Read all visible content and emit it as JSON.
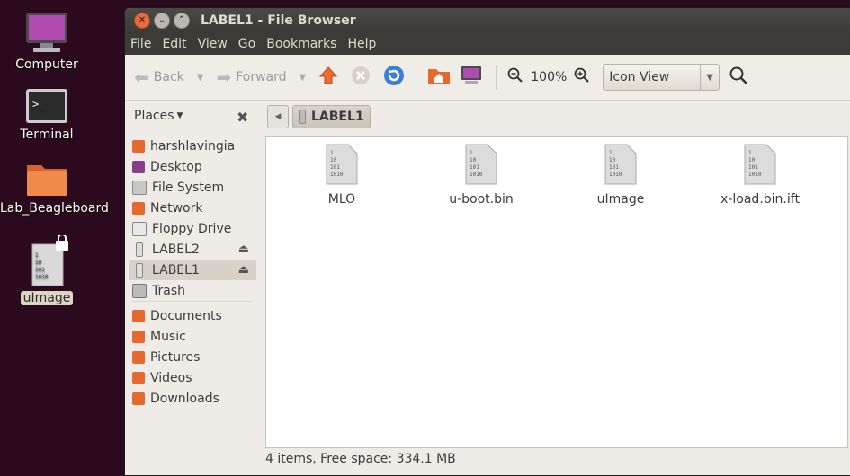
{
  "desktop": {
    "icons": [
      {
        "label": "Computer"
      },
      {
        "label": "Terminal"
      },
      {
        "label": "Lab_Beagleboard"
      },
      {
        "label": "uImage"
      }
    ]
  },
  "window": {
    "title": "LABEL1 - File Browser",
    "menu": [
      "File",
      "Edit",
      "View",
      "Go",
      "Bookmarks",
      "Help"
    ],
    "toolbar": {
      "back": "Back",
      "forward": "Forward",
      "zoom": "100%",
      "view_mode": "Icon View"
    },
    "places_label": "Places",
    "breadcrumb": "LABEL1",
    "sidebar": [
      {
        "label": "harshlavingia",
        "icon": "home-icon"
      },
      {
        "label": "Desktop",
        "icon": "desktop-icon"
      },
      {
        "label": "File System",
        "icon": "drive-icon"
      },
      {
        "label": "Network",
        "icon": "network-icon"
      },
      {
        "label": "Floppy Drive",
        "icon": "floppy-icon"
      },
      {
        "label": "LABEL2",
        "icon": "usb-icon"
      },
      {
        "label": "LABEL1",
        "icon": "usb-icon"
      },
      {
        "label": "Trash",
        "icon": "trash-icon"
      },
      {
        "label": "Documents",
        "icon": "folder-icon"
      },
      {
        "label": "Music",
        "icon": "folder-icon"
      },
      {
        "label": "Pictures",
        "icon": "folder-icon"
      },
      {
        "label": "Videos",
        "icon": "folder-icon"
      },
      {
        "label": "Downloads",
        "icon": "folder-icon"
      }
    ],
    "files": [
      {
        "name": "MLO"
      },
      {
        "name": "u-boot.bin"
      },
      {
        "name": "uImage"
      },
      {
        "name": "x-load.bin.ift"
      }
    ],
    "status": "4 items, Free space: 334.1 MB"
  }
}
